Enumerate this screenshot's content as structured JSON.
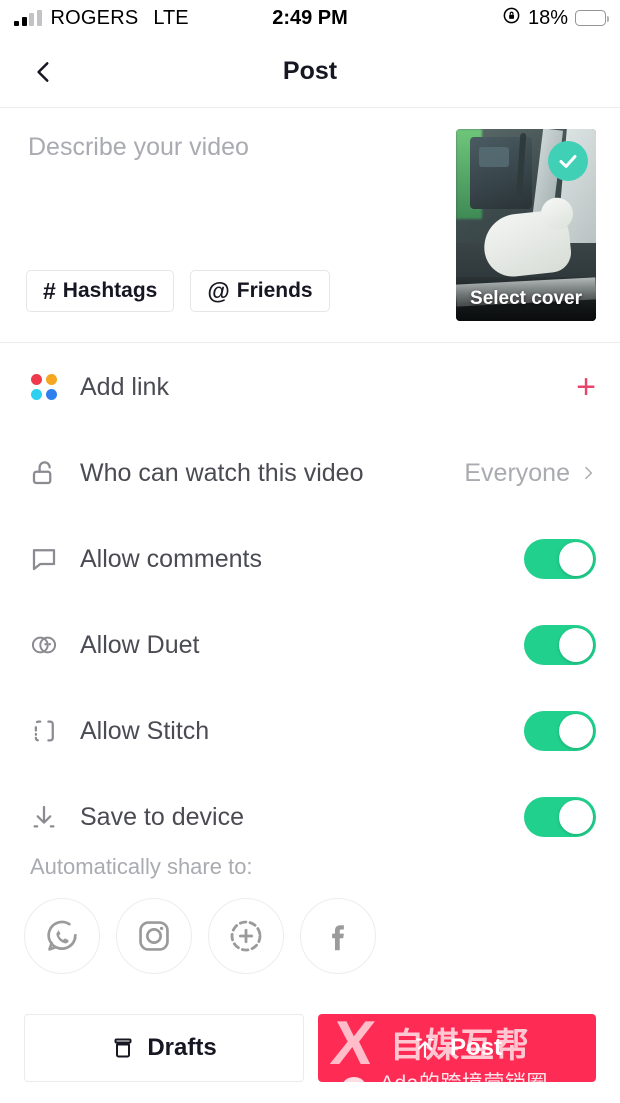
{
  "status_bar": {
    "carrier": "ROGERS",
    "network": "LTE",
    "time": "2:49 PM",
    "battery_percent": "18%",
    "battery_level": 18,
    "battery_color": "#f63d3d",
    "rotation_lock_icon": "rotation-lock-icon",
    "signal_icon": "signal-bars-icon"
  },
  "nav": {
    "title": "Post",
    "back_icon": "chevron-left-icon"
  },
  "caption": {
    "placeholder": "Describe your video",
    "value": "",
    "pills": [
      {
        "glyph": "#",
        "label": "Hashtags",
        "icon": "hashtag-icon"
      },
      {
        "glyph": "@",
        "label": "Friends",
        "icon": "at-mention-icon"
      }
    ]
  },
  "cover": {
    "label": "Select cover",
    "badge_icon": "check-circle-icon",
    "badge_color": "#3fd0b6"
  },
  "settings": [
    {
      "label": "Add link",
      "icon": "four-dots-grid-icon",
      "control": "plus",
      "plus_glyph": "+",
      "accent": "#e8456b",
      "dot_colors": [
        "#f0394d",
        "#f5a623",
        "#2ed0f0",
        "#2f80ed"
      ]
    },
    {
      "label": "Who can watch this video",
      "icon": "unlock-icon",
      "control": "value",
      "value": "Everyone",
      "chevron_icon": "chevron-right-icon"
    },
    {
      "label": "Allow comments",
      "icon": "comment-bubble-icon",
      "control": "toggle",
      "toggle_on": true
    },
    {
      "label": "Allow Duet",
      "icon": "duet-icon",
      "control": "toggle",
      "toggle_on": true
    },
    {
      "label": "Allow Stitch",
      "icon": "stitch-icon",
      "control": "toggle",
      "toggle_on": true
    },
    {
      "label": "Save to device",
      "icon": "download-icon",
      "control": "toggle",
      "toggle_on": true
    }
  ],
  "toggle_on_color": "#20d08c",
  "share": {
    "title": "Automatically share to:",
    "targets": [
      {
        "name": "whatsapp",
        "icon": "whatsapp-icon"
      },
      {
        "name": "instagram",
        "icon": "instagram-icon"
      },
      {
        "name": "instagram-stories",
        "icon": "instagram-stories-icon"
      },
      {
        "name": "facebook",
        "icon": "facebook-icon"
      }
    ]
  },
  "bottom_bar": {
    "drafts_label": "Drafts",
    "drafts_icon": "archive-box-icon",
    "post_label": "Post",
    "post_icon": "upload-arrow-icon",
    "post_color": "#fe2c55"
  },
  "watermark": {
    "logo": "X",
    "cn_text": "自媒互帮",
    "handle": "Ada的跨境营销圈",
    "wechat_icon": "wechat-icon"
  }
}
